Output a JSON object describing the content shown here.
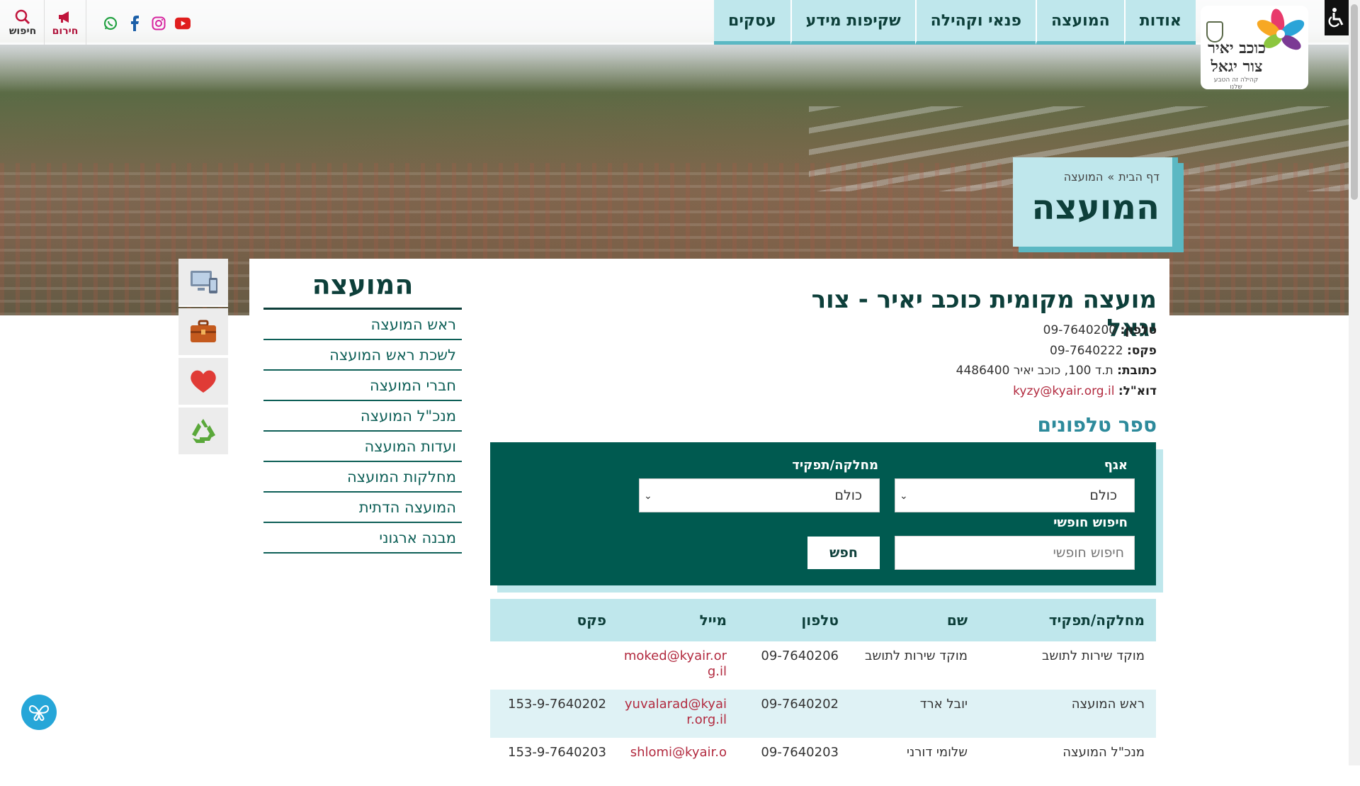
{
  "topbar": {
    "search_label": "חיפוש",
    "alert_label": "חירום",
    "social": [
      "whatsapp-icon",
      "facebook-icon",
      "instagram-icon",
      "youtube-icon"
    ]
  },
  "nav": {
    "items": [
      {
        "label": "עסקים"
      },
      {
        "label": "שקיפות מידע"
      },
      {
        "label": "פנאי וקהילה"
      },
      {
        "label": "המועצה"
      },
      {
        "label": "אודות"
      }
    ]
  },
  "logo": {
    "line1": "כוכב יאיר",
    "line2": "צור יגאל",
    "tagline": "קהילה זה הטבע שלנו"
  },
  "hero": {
    "breadcrumb_home": "דף הבית",
    "breadcrumb_sep": "»",
    "breadcrumb_current": "המועצה",
    "title": "המועצה"
  },
  "side_icons": [
    "computer-icon",
    "briefcase-icon",
    "heart-icon",
    "recycle-icon"
  ],
  "submenu": {
    "title": "המועצה",
    "items": [
      "ראש המועצה",
      "לשכת ראש המועצה",
      "חברי המועצה",
      "מנכ\"ל המועצה",
      "ועדות המועצה",
      "מחלקות המועצה",
      "המועצה הדתית",
      "מבנה ארגוני"
    ]
  },
  "council": {
    "name": "מועצה מקומית כוכב יאיר - צור יגאל",
    "phone_label": "טלפון:",
    "phone": "09-7640200",
    "fax_label": "פקס:",
    "fax": "09-7640222",
    "address_label": "כתובת:",
    "address": "ת.ד 100, כוכב יאיר 4486400",
    "email_label": "דוא\"ל:",
    "email": "kyzy@kyair.org.il"
  },
  "phonebook": {
    "title": "ספר טלפונים",
    "branch_label": "אגף",
    "branch_value": "כולם",
    "dept_label": "מחלקה/תפקיד",
    "dept_value": "כולם",
    "free_search_label": "חיפוש חופשי",
    "free_search_placeholder": "חיפוש חופשי",
    "search_button": "חפש",
    "columns": [
      "מחלקה/תפקיד",
      "שם",
      "טלפון",
      "מייל",
      "פקס"
    ],
    "rows": [
      {
        "dept": "מוקד שירות לתושב",
        "name": "מוקד שירות לתושב",
        "phone": "09-7640206",
        "email": "moked@kyair.org.il",
        "fax": ""
      },
      {
        "dept": "ראש המועצה",
        "name": "יובל ארד",
        "phone": "09-7640202",
        "email": "yuvalarad@kyair.org.il",
        "fax": "153-9-7640202"
      },
      {
        "dept": "מנכ\"ל המועצה",
        "name": "שלומי דורני",
        "phone": "09-7640203",
        "email": "shlomi@kyair.o",
        "fax": "153-9-7640203"
      }
    ]
  },
  "colors": {
    "primary_dark": "#005a50",
    "accent_light": "#bfe7ec",
    "accent": "#5bb8c3",
    "link_red": "#b22a3f"
  }
}
